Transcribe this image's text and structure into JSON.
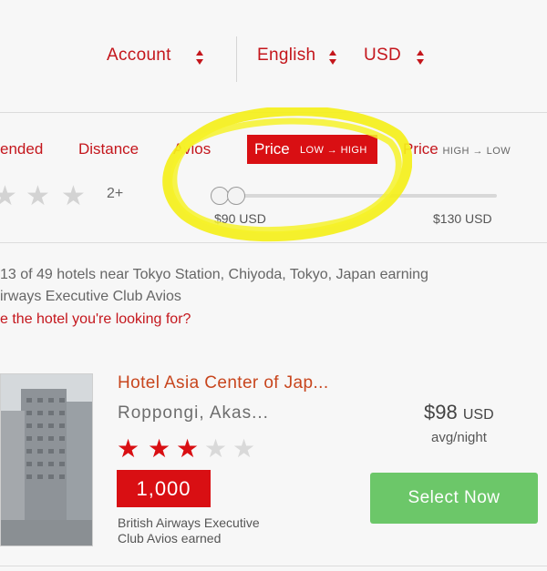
{
  "header": {
    "account_label": "Account",
    "language_label": "English",
    "currency_label": "USD"
  },
  "sort": {
    "recommended_label": "ended",
    "distance_label": "Distance",
    "avios_label": "Avios",
    "price_low_label": "Price",
    "price_low_sub": "LOW → HIGH",
    "price_high_label": "Price",
    "price_high_sub": "HIGH → LOW"
  },
  "star_filter": {
    "label": "2+"
  },
  "price_range": {
    "min_label": "$90 USD",
    "max_label": "$130 USD"
  },
  "results": {
    "summary_line1": "13 of 49 hotels near Tokyo Station, Chiyoda, Tokyo, Japan earning",
    "summary_line2": "irways Executive Club Avios",
    "help_link": "e the hotel you're looking for?"
  },
  "hotel": {
    "name": "Hotel Asia Center of Jap...",
    "location": "Roppongi, Akas...",
    "price": "$98",
    "currency": "USD",
    "per_night": "avg/night",
    "rating": 3,
    "max_rating": 5,
    "avios": "1,000",
    "avios_line1": "British Airways Executive",
    "avios_line2": "Club Avios earned",
    "select_label": "Select Now"
  },
  "colors": {
    "brand_red": "#c4161c",
    "active_red": "#d90f13",
    "select_green": "#6cc769",
    "highlight_yellow": "#f4ef1a"
  }
}
